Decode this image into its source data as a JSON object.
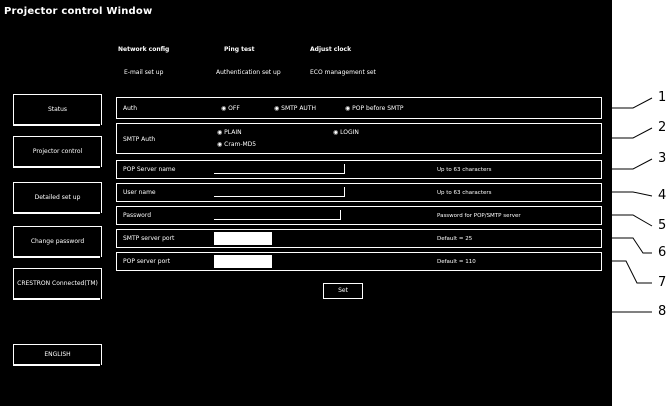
{
  "window_title": "Projector control Window",
  "top_tabs": {
    "row1": [
      "Network config",
      "Ping test",
      "Adjust clock"
    ],
    "row2": [
      "E-mail set up",
      "Authentication set up",
      "ECO management set"
    ]
  },
  "sidebar": {
    "items": [
      {
        "label": "Status"
      },
      {
        "label": "Projector control"
      },
      {
        "label": "Detailed set up"
      },
      {
        "label": "Change password"
      },
      {
        "label": "CRESTRON Connected(TM)"
      },
      {
        "label": "ENGLISH"
      }
    ]
  },
  "form": {
    "auth_label": "Auth",
    "auth_options": [
      "OFF",
      "SMTP AUTH",
      "POP before SMTP"
    ],
    "smtp_auth_label": "SMTP Auth",
    "smtp_auth_options": [
      "PLAIN",
      "LOGIN",
      "Cram-MD5"
    ],
    "pop_server_label": "POP Server name",
    "pop_server_hint": "Up to 63 characters",
    "user_name_label": "User name",
    "user_name_hint": "Up to 63 characters",
    "password_label": "Password",
    "password_hint": "Password for POP/SMTP server",
    "smtp_port_label": "SMTP server port",
    "smtp_port_hint": "Default = 25",
    "pop_port_label": "POP server port",
    "pop_port_hint": "Default = 110",
    "set_button": "Set"
  },
  "callouts": [
    "1",
    "2",
    "3",
    "4",
    "5",
    "6",
    "7",
    "8"
  ]
}
